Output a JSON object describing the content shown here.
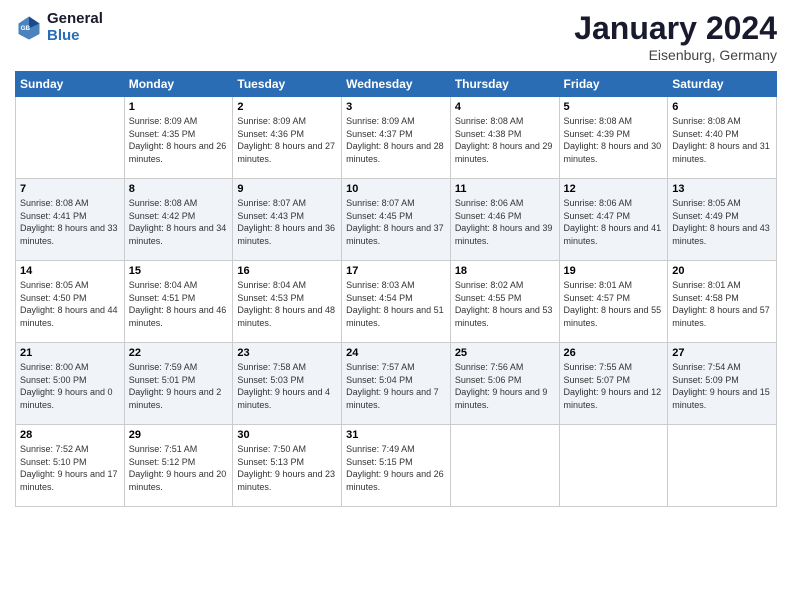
{
  "logo": {
    "line1": "General",
    "line2": "Blue"
  },
  "title": "January 2024",
  "subtitle": "Eisenburg, Germany",
  "days_of_week": [
    "Sunday",
    "Monday",
    "Tuesday",
    "Wednesday",
    "Thursday",
    "Friday",
    "Saturday"
  ],
  "weeks": [
    [
      {
        "day": "",
        "sunrise": "",
        "sunset": "",
        "daylight": ""
      },
      {
        "day": "1",
        "sunrise": "Sunrise: 8:09 AM",
        "sunset": "Sunset: 4:35 PM",
        "daylight": "Daylight: 8 hours and 26 minutes."
      },
      {
        "day": "2",
        "sunrise": "Sunrise: 8:09 AM",
        "sunset": "Sunset: 4:36 PM",
        "daylight": "Daylight: 8 hours and 27 minutes."
      },
      {
        "day": "3",
        "sunrise": "Sunrise: 8:09 AM",
        "sunset": "Sunset: 4:37 PM",
        "daylight": "Daylight: 8 hours and 28 minutes."
      },
      {
        "day": "4",
        "sunrise": "Sunrise: 8:08 AM",
        "sunset": "Sunset: 4:38 PM",
        "daylight": "Daylight: 8 hours and 29 minutes."
      },
      {
        "day": "5",
        "sunrise": "Sunrise: 8:08 AM",
        "sunset": "Sunset: 4:39 PM",
        "daylight": "Daylight: 8 hours and 30 minutes."
      },
      {
        "day": "6",
        "sunrise": "Sunrise: 8:08 AM",
        "sunset": "Sunset: 4:40 PM",
        "daylight": "Daylight: 8 hours and 31 minutes."
      }
    ],
    [
      {
        "day": "7",
        "sunrise": "Sunrise: 8:08 AM",
        "sunset": "Sunset: 4:41 PM",
        "daylight": "Daylight: 8 hours and 33 minutes."
      },
      {
        "day": "8",
        "sunrise": "Sunrise: 8:08 AM",
        "sunset": "Sunset: 4:42 PM",
        "daylight": "Daylight: 8 hours and 34 minutes."
      },
      {
        "day": "9",
        "sunrise": "Sunrise: 8:07 AM",
        "sunset": "Sunset: 4:43 PM",
        "daylight": "Daylight: 8 hours and 36 minutes."
      },
      {
        "day": "10",
        "sunrise": "Sunrise: 8:07 AM",
        "sunset": "Sunset: 4:45 PM",
        "daylight": "Daylight: 8 hours and 37 minutes."
      },
      {
        "day": "11",
        "sunrise": "Sunrise: 8:06 AM",
        "sunset": "Sunset: 4:46 PM",
        "daylight": "Daylight: 8 hours and 39 minutes."
      },
      {
        "day": "12",
        "sunrise": "Sunrise: 8:06 AM",
        "sunset": "Sunset: 4:47 PM",
        "daylight": "Daylight: 8 hours and 41 minutes."
      },
      {
        "day": "13",
        "sunrise": "Sunrise: 8:05 AM",
        "sunset": "Sunset: 4:49 PM",
        "daylight": "Daylight: 8 hours and 43 minutes."
      }
    ],
    [
      {
        "day": "14",
        "sunrise": "Sunrise: 8:05 AM",
        "sunset": "Sunset: 4:50 PM",
        "daylight": "Daylight: 8 hours and 44 minutes."
      },
      {
        "day": "15",
        "sunrise": "Sunrise: 8:04 AM",
        "sunset": "Sunset: 4:51 PM",
        "daylight": "Daylight: 8 hours and 46 minutes."
      },
      {
        "day": "16",
        "sunrise": "Sunrise: 8:04 AM",
        "sunset": "Sunset: 4:53 PM",
        "daylight": "Daylight: 8 hours and 48 minutes."
      },
      {
        "day": "17",
        "sunrise": "Sunrise: 8:03 AM",
        "sunset": "Sunset: 4:54 PM",
        "daylight": "Daylight: 8 hours and 51 minutes."
      },
      {
        "day": "18",
        "sunrise": "Sunrise: 8:02 AM",
        "sunset": "Sunset: 4:55 PM",
        "daylight": "Daylight: 8 hours and 53 minutes."
      },
      {
        "day": "19",
        "sunrise": "Sunrise: 8:01 AM",
        "sunset": "Sunset: 4:57 PM",
        "daylight": "Daylight: 8 hours and 55 minutes."
      },
      {
        "day": "20",
        "sunrise": "Sunrise: 8:01 AM",
        "sunset": "Sunset: 4:58 PM",
        "daylight": "Daylight: 8 hours and 57 minutes."
      }
    ],
    [
      {
        "day": "21",
        "sunrise": "Sunrise: 8:00 AM",
        "sunset": "Sunset: 5:00 PM",
        "daylight": "Daylight: 9 hours and 0 minutes."
      },
      {
        "day": "22",
        "sunrise": "Sunrise: 7:59 AM",
        "sunset": "Sunset: 5:01 PM",
        "daylight": "Daylight: 9 hours and 2 minutes."
      },
      {
        "day": "23",
        "sunrise": "Sunrise: 7:58 AM",
        "sunset": "Sunset: 5:03 PM",
        "daylight": "Daylight: 9 hours and 4 minutes."
      },
      {
        "day": "24",
        "sunrise": "Sunrise: 7:57 AM",
        "sunset": "Sunset: 5:04 PM",
        "daylight": "Daylight: 9 hours and 7 minutes."
      },
      {
        "day": "25",
        "sunrise": "Sunrise: 7:56 AM",
        "sunset": "Sunset: 5:06 PM",
        "daylight": "Daylight: 9 hours and 9 minutes."
      },
      {
        "day": "26",
        "sunrise": "Sunrise: 7:55 AM",
        "sunset": "Sunset: 5:07 PM",
        "daylight": "Daylight: 9 hours and 12 minutes."
      },
      {
        "day": "27",
        "sunrise": "Sunrise: 7:54 AM",
        "sunset": "Sunset: 5:09 PM",
        "daylight": "Daylight: 9 hours and 15 minutes."
      }
    ],
    [
      {
        "day": "28",
        "sunrise": "Sunrise: 7:52 AM",
        "sunset": "Sunset: 5:10 PM",
        "daylight": "Daylight: 9 hours and 17 minutes."
      },
      {
        "day": "29",
        "sunrise": "Sunrise: 7:51 AM",
        "sunset": "Sunset: 5:12 PM",
        "daylight": "Daylight: 9 hours and 20 minutes."
      },
      {
        "day": "30",
        "sunrise": "Sunrise: 7:50 AM",
        "sunset": "Sunset: 5:13 PM",
        "daylight": "Daylight: 9 hours and 23 minutes."
      },
      {
        "day": "31",
        "sunrise": "Sunrise: 7:49 AM",
        "sunset": "Sunset: 5:15 PM",
        "daylight": "Daylight: 9 hours and 26 minutes."
      },
      {
        "day": "",
        "sunrise": "",
        "sunset": "",
        "daylight": ""
      },
      {
        "day": "",
        "sunrise": "",
        "sunset": "",
        "daylight": ""
      },
      {
        "day": "",
        "sunrise": "",
        "sunset": "",
        "daylight": ""
      }
    ]
  ]
}
